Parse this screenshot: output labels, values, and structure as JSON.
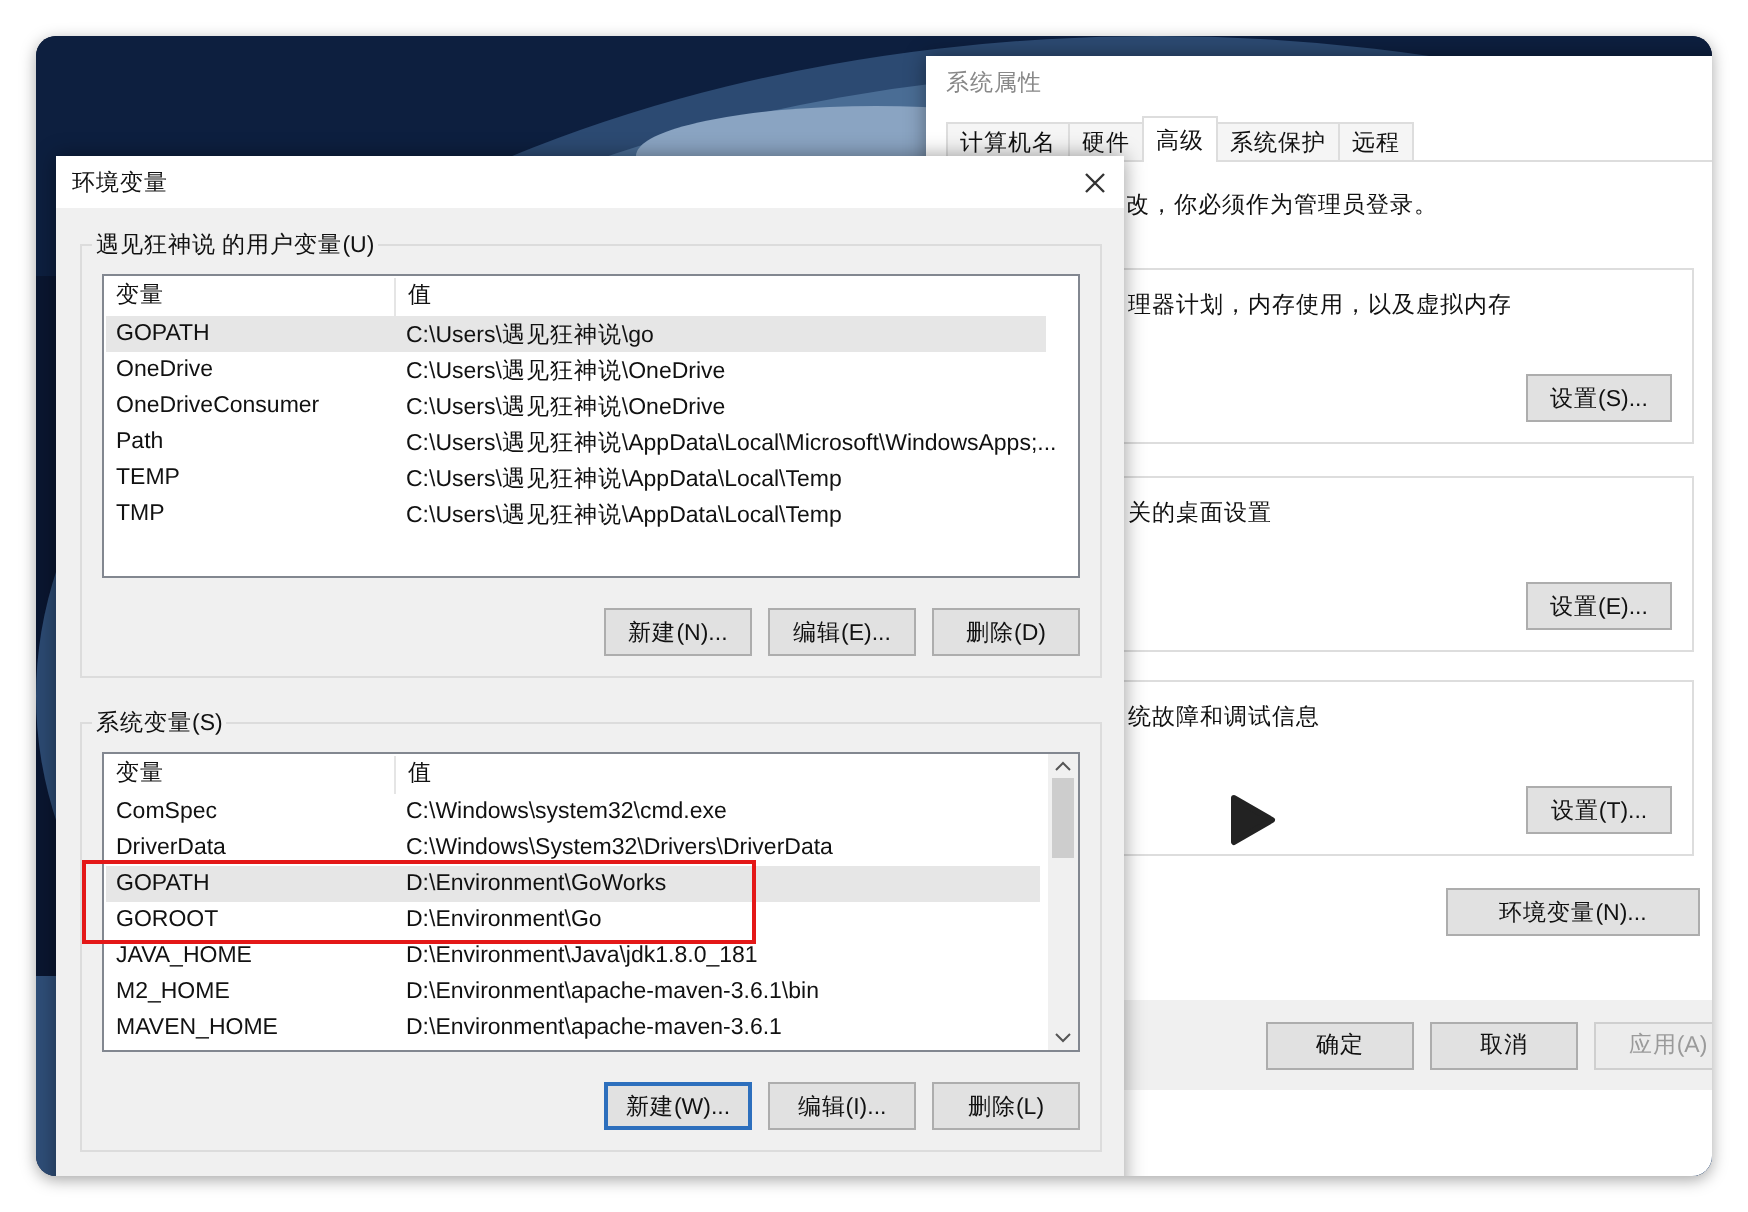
{
  "system_properties": {
    "title": "系统属性",
    "tabs": [
      {
        "label": "计算机名",
        "selected": false
      },
      {
        "label": "硬件",
        "selected": false
      },
      {
        "label": "高级",
        "selected": true
      },
      {
        "label": "系统保护",
        "selected": false
      },
      {
        "label": "远程",
        "selected": false
      }
    ],
    "notice": "改，你必须作为管理员登录。",
    "groups": [
      {
        "text": "理器计划，内存使用，以及虚拟内存",
        "button": "设置(S)..."
      },
      {
        "text": "关的桌面设置",
        "button": "设置(E)..."
      },
      {
        "text": "统故障和调试信息",
        "button": "设置(T)..."
      }
    ],
    "env_button": "环境变量(N)...",
    "footer_buttons": [
      {
        "label": "确定",
        "disabled": false
      },
      {
        "label": "取消",
        "disabled": false
      },
      {
        "label": "应用(A)",
        "disabled": true
      }
    ]
  },
  "env_dialog": {
    "title": "环境变量",
    "user_group": {
      "legend": "遇见狂神说 的用户变量(U)",
      "columns": [
        "变量",
        "值"
      ],
      "rows": [
        {
          "name": "GOPATH",
          "value": "C:\\Users\\遇见狂神说\\go",
          "selected": true
        },
        {
          "name": "OneDrive",
          "value": "C:\\Users\\遇见狂神说\\OneDrive",
          "selected": false
        },
        {
          "name": "OneDriveConsumer",
          "value": "C:\\Users\\遇见狂神说\\OneDrive",
          "selected": false
        },
        {
          "name": "Path",
          "value": "C:\\Users\\遇见狂神说\\AppData\\Local\\Microsoft\\WindowsApps;...",
          "selected": false
        },
        {
          "name": "TEMP",
          "value": "C:\\Users\\遇见狂神说\\AppData\\Local\\Temp",
          "selected": false
        },
        {
          "name": "TMP",
          "value": "C:\\Users\\遇见狂神说\\AppData\\Local\\Temp",
          "selected": false
        }
      ],
      "buttons": [
        {
          "label": "新建(N)...",
          "focused": false
        },
        {
          "label": "编辑(E)...",
          "focused": false
        },
        {
          "label": "删除(D)",
          "focused": false
        }
      ]
    },
    "system_group": {
      "legend": "系统变量(S)",
      "columns": [
        "变量",
        "值"
      ],
      "rows": [
        {
          "name": "ComSpec",
          "value": "C:\\Windows\\system32\\cmd.exe",
          "selected": false,
          "outlined": false
        },
        {
          "name": "DriverData",
          "value": "C:\\Windows\\System32\\Drivers\\DriverData",
          "selected": false,
          "outlined": false
        },
        {
          "name": "GOPATH",
          "value": "D:\\Environment\\GoWorks",
          "selected": true,
          "outlined": true
        },
        {
          "name": "GOROOT",
          "value": "D:\\Environment\\Go",
          "selected": false,
          "outlined": true
        },
        {
          "name": "JAVA_HOME",
          "value": "D:\\Environment\\Java\\jdk1.8.0_181",
          "selected": false,
          "outlined": false
        },
        {
          "name": "M2_HOME",
          "value": "D:\\Environment\\apache-maven-3.6.1\\bin",
          "selected": false,
          "outlined": false
        },
        {
          "name": "MAVEN_HOME",
          "value": "D:\\Environment\\apache-maven-3.6.1",
          "selected": false,
          "outlined": false
        }
      ],
      "buttons": [
        {
          "label": "新建(W)...",
          "focused": true
        },
        {
          "label": "编辑(I)...",
          "focused": false
        },
        {
          "label": "删除(L)",
          "focused": false
        }
      ]
    }
  }
}
